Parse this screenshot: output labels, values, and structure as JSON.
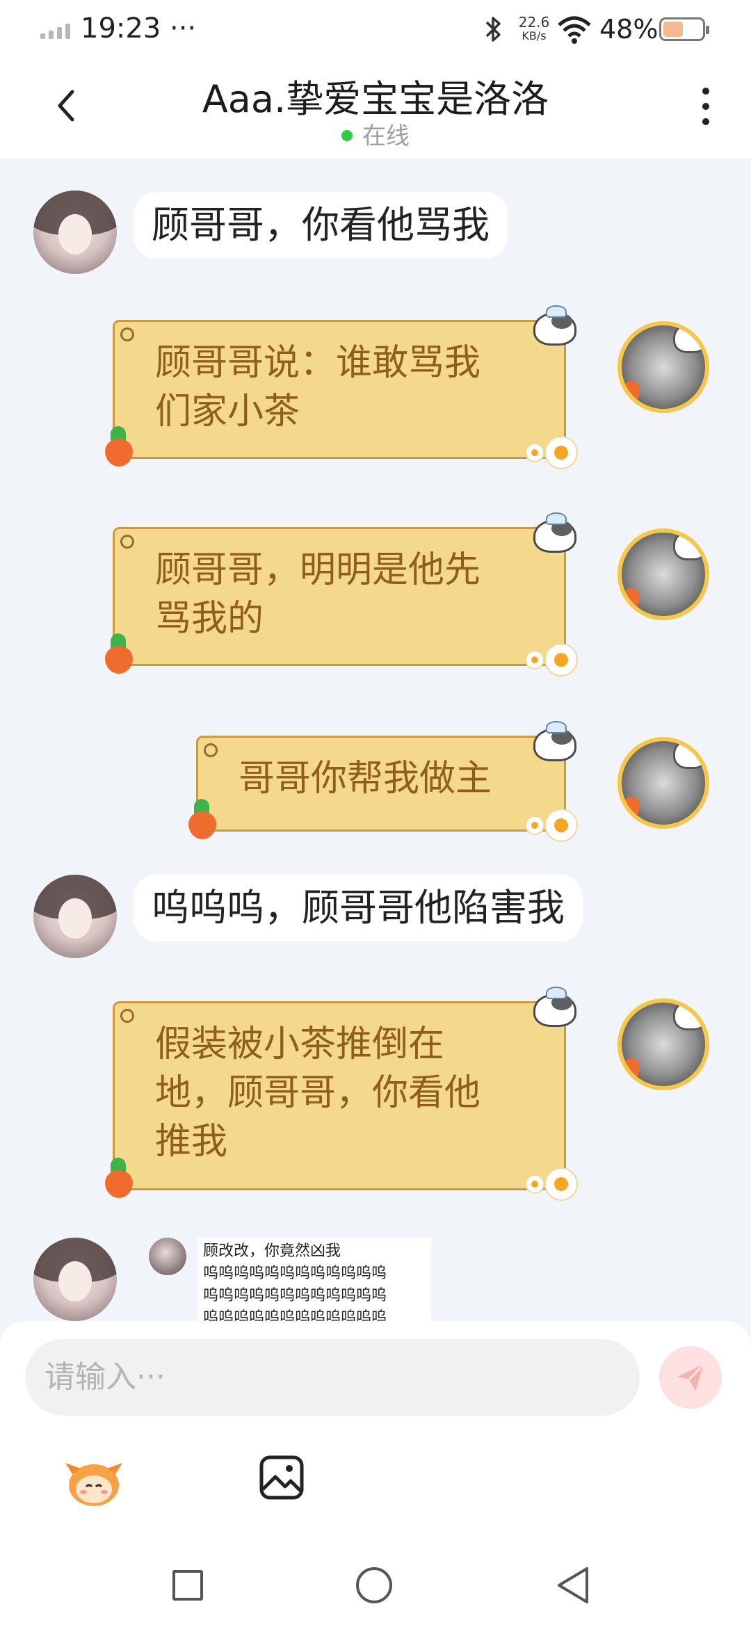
{
  "status_bar": {
    "time": "19:23",
    "dots": "···",
    "net_speed_value": "22.6",
    "net_speed_unit": "KB/s",
    "battery": "48%",
    "battery_level": 0.48
  },
  "header": {
    "title": "Aaa.挚爱宝宝是洛洛",
    "status": "在线"
  },
  "messages": [
    {
      "side": "left",
      "text": "顾哥哥，你看他骂我"
    },
    {
      "side": "right",
      "lines": [
        "顾哥哥说：谁敢骂我",
        "们家小茶"
      ]
    },
    {
      "side": "right",
      "lines": [
        "顾哥哥，明明是他先",
        "骂我的"
      ]
    },
    {
      "side": "right",
      "lines": [
        "哥哥你帮我做主"
      ]
    },
    {
      "side": "left",
      "text": "呜呜呜，顾哥哥他陷害我"
    },
    {
      "side": "right",
      "lines": [
        "假装被小茶推倒在",
        "地，顾哥哥，你看他",
        "推我"
      ]
    },
    {
      "side": "left",
      "type": "image",
      "lines": [
        "顾改改，你竟然凶我",
        "呜呜呜呜呜呜呜呜呜呜呜呜",
        "呜呜呜呜呜呜呜呜呜呜呜呜",
        "呜呜呜呜呜呜呜呜呜呜呜呜"
      ]
    }
  ],
  "composer": {
    "placeholder": "请输入···"
  },
  "colors": {
    "online_dot": "#2ecc40",
    "bubble_yellow": "#f4d98d",
    "bubble_text": "#8f5e1d",
    "send_button": "#fde0e0"
  },
  "icons": {
    "back": "chevron-left-icon",
    "more": "more-vertical-icon",
    "send": "paper-plane-icon",
    "emoji": "sticker-face-icon",
    "image": "image-icon",
    "nav_recents": "square-icon",
    "nav_home": "circle-icon",
    "nav_back": "triangle-back-icon"
  }
}
